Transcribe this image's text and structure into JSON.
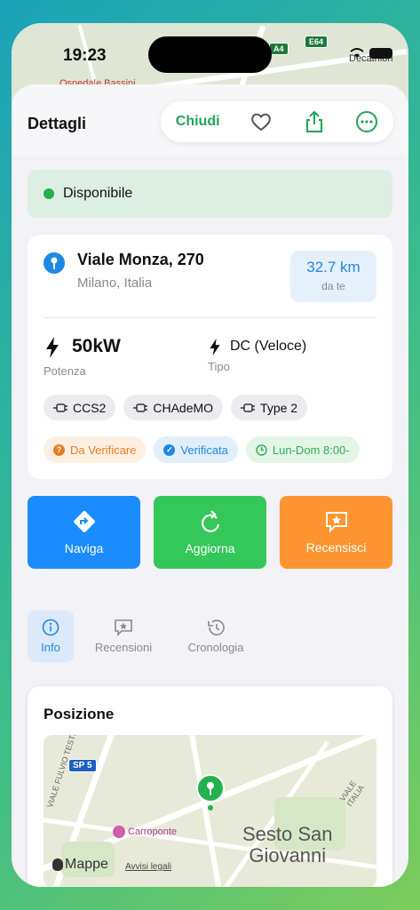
{
  "status_bar": {
    "time": "19:23"
  },
  "top_map": {
    "labels": [
      "Ospedale Bassini",
      "A4",
      "E64",
      "Decathlon"
    ]
  },
  "header": {
    "title": "Dettagli",
    "close_label": "Chiudi"
  },
  "availability": {
    "text": "Disponibile",
    "color": "#22b14c"
  },
  "location": {
    "address": "Viale Monza, 270",
    "city": "Milano, Italia",
    "distance_value": "32.7 km",
    "distance_label": "da te"
  },
  "specs": {
    "power_value": "50kW",
    "power_label": "Potenza",
    "type_value": "DC (Veloce)",
    "type_label": "Tipo"
  },
  "connectors": [
    "CCS2",
    "CHAdeMO",
    "Type 2"
  ],
  "badges": [
    {
      "label": "Da Verificare",
      "icon": "question-icon"
    },
    {
      "label": "Verificata",
      "icon": "verified-icon"
    },
    {
      "label": "Lun-Dom 8:00-",
      "icon": "clock-icon"
    }
  ],
  "actions": [
    {
      "label": "Naviga",
      "icon": "directions-icon",
      "color": "#1a8cff"
    },
    {
      "label": "Aggiorna",
      "icon": "refresh-icon",
      "color": "#34c759"
    },
    {
      "label": "Recensisci",
      "icon": "review-star-icon",
      "color": "#ff9530"
    }
  ],
  "tabs": [
    {
      "label": "Info",
      "icon": "info-icon"
    },
    {
      "label": "Recensioni",
      "icon": "reviews-icon"
    },
    {
      "label": "Cronologia",
      "icon": "history-icon"
    }
  ],
  "position": {
    "title": "Posizione",
    "map_labels": {
      "road_shield": "SP 5",
      "street1": "VIALE FULVIO TESTI",
      "street2": "VIALE ITALIA",
      "poi": "Carroponte",
      "city_line1": "Sesto San",
      "city_line2": "Giovanni",
      "brand": "Mappe",
      "legal": "Avvisi legali"
    }
  },
  "accent_colors": {
    "green": "#22a35a",
    "blue": "#1e88e5",
    "orange": "#e67e22"
  }
}
